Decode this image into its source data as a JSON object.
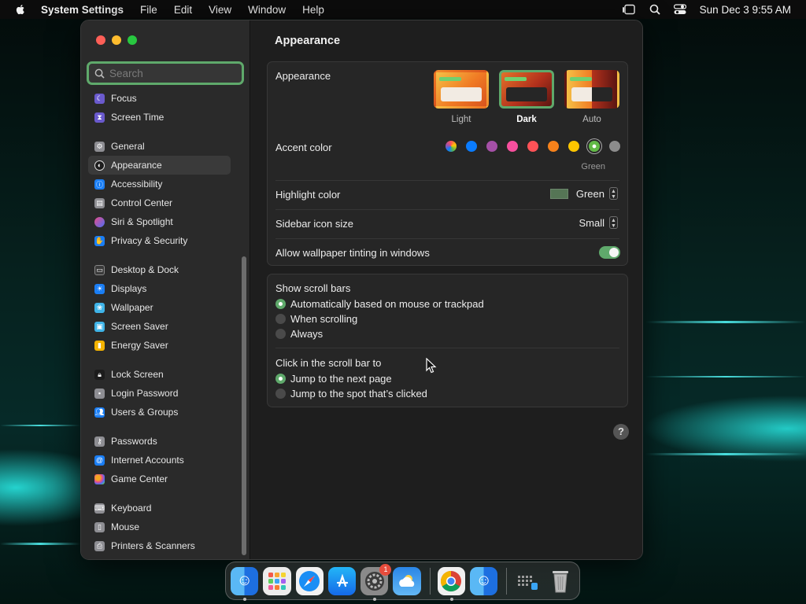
{
  "menubar": {
    "app_name": "System Settings",
    "menus": [
      "File",
      "Edit",
      "View",
      "Window",
      "Help"
    ],
    "clock": "Sun Dec 3  9:55 AM"
  },
  "sidebar": {
    "search_placeholder": "Search",
    "items": [
      {
        "label": "Focus",
        "icon": "moon-icon",
        "color": "#6a5acd"
      },
      {
        "label": "Screen Time",
        "icon": "hourglass-icon",
        "color": "#6a5acd"
      },
      {
        "label": "General",
        "icon": "gear-icon",
        "color": "#8e8e93"
      },
      {
        "label": "Appearance",
        "icon": "appearance-icon",
        "color": "#1c1c1c"
      },
      {
        "label": "Accessibility",
        "icon": "accessibility-icon",
        "color": "#1a7ef5"
      },
      {
        "label": "Control Center",
        "icon": "control-center-icon",
        "color": "#8e8e93"
      },
      {
        "label": "Siri & Spotlight",
        "icon": "siri-icon",
        "color": "#b04fd8"
      },
      {
        "label": "Privacy & Security",
        "icon": "hand-icon",
        "color": "#1a7ef5"
      },
      {
        "label": "Desktop & Dock",
        "icon": "dock-icon",
        "color": "#3a3a3a"
      },
      {
        "label": "Displays",
        "icon": "sun-icon",
        "color": "#1a7ef5"
      },
      {
        "label": "Wallpaper",
        "icon": "wallpaper-icon",
        "color": "#3fb4e8"
      },
      {
        "label": "Screen Saver",
        "icon": "screen-saver-icon",
        "color": "#3fb4e8"
      },
      {
        "label": "Energy Saver",
        "icon": "battery-icon",
        "color": "#f5b400"
      },
      {
        "label": "Lock Screen",
        "icon": "lock-icon",
        "color": "#1c1c1c"
      },
      {
        "label": "Login Password",
        "icon": "login-lock-icon",
        "color": "#8e8e93"
      },
      {
        "label": "Users & Groups",
        "icon": "users-icon",
        "color": "#1a7ef5"
      },
      {
        "label": "Passwords",
        "icon": "key-icon",
        "color": "#8e8e93"
      },
      {
        "label": "Internet Accounts",
        "icon": "at-icon",
        "color": "#1a7ef5"
      },
      {
        "label": "Game Center",
        "icon": "game-center-icon",
        "color": "#e8e8e8"
      },
      {
        "label": "Keyboard",
        "icon": "keyboard-icon",
        "color": "#8e8e93"
      },
      {
        "label": "Mouse",
        "icon": "mouse-icon",
        "color": "#8e8e93"
      },
      {
        "label": "Printers & Scanners",
        "icon": "printer-icon",
        "color": "#8e8e93"
      }
    ],
    "selected": "Appearance"
  },
  "content": {
    "title": "Appearance",
    "appearance": {
      "label": "Appearance",
      "options": [
        {
          "name": "Light",
          "selected": false
        },
        {
          "name": "Dark",
          "selected": true
        },
        {
          "name": "Auto",
          "selected": false
        }
      ]
    },
    "accent": {
      "label": "Accent color",
      "colors": [
        "multicolor",
        "#0a7cff",
        "#a550a7",
        "#f74f9e",
        "#ff5257",
        "#f7821b",
        "#ffc600",
        "#62ba46",
        "#8c8c8c"
      ],
      "selected_name": "Green"
    },
    "highlight": {
      "label": "Highlight color",
      "value": "Green",
      "swatch": "#557555"
    },
    "sidebar_icon_size": {
      "label": "Sidebar icon size",
      "value": "Small"
    },
    "wallpaper_tinting": {
      "label": "Allow wallpaper tinting in windows",
      "on": true
    },
    "scroll_bars": {
      "label": "Show scroll bars",
      "options": [
        "Automatically based on mouse or trackpad",
        "When scrolling",
        "Always"
      ],
      "selected": 0
    },
    "click_scroll": {
      "label": "Click in the scroll bar to",
      "options": [
        "Jump to the next page",
        "Jump to the spot that’s clicked"
      ],
      "selected": 0
    },
    "help": "?"
  },
  "dock": {
    "apps": [
      "finder-icon",
      "launchpad-icon",
      "safari-icon",
      "app-store-icon",
      "system-settings-icon",
      "weather-icon",
      "chrome-icon",
      "finder-2-icon",
      "grid-icon",
      "trash-icon"
    ],
    "settings_badge": "1"
  }
}
